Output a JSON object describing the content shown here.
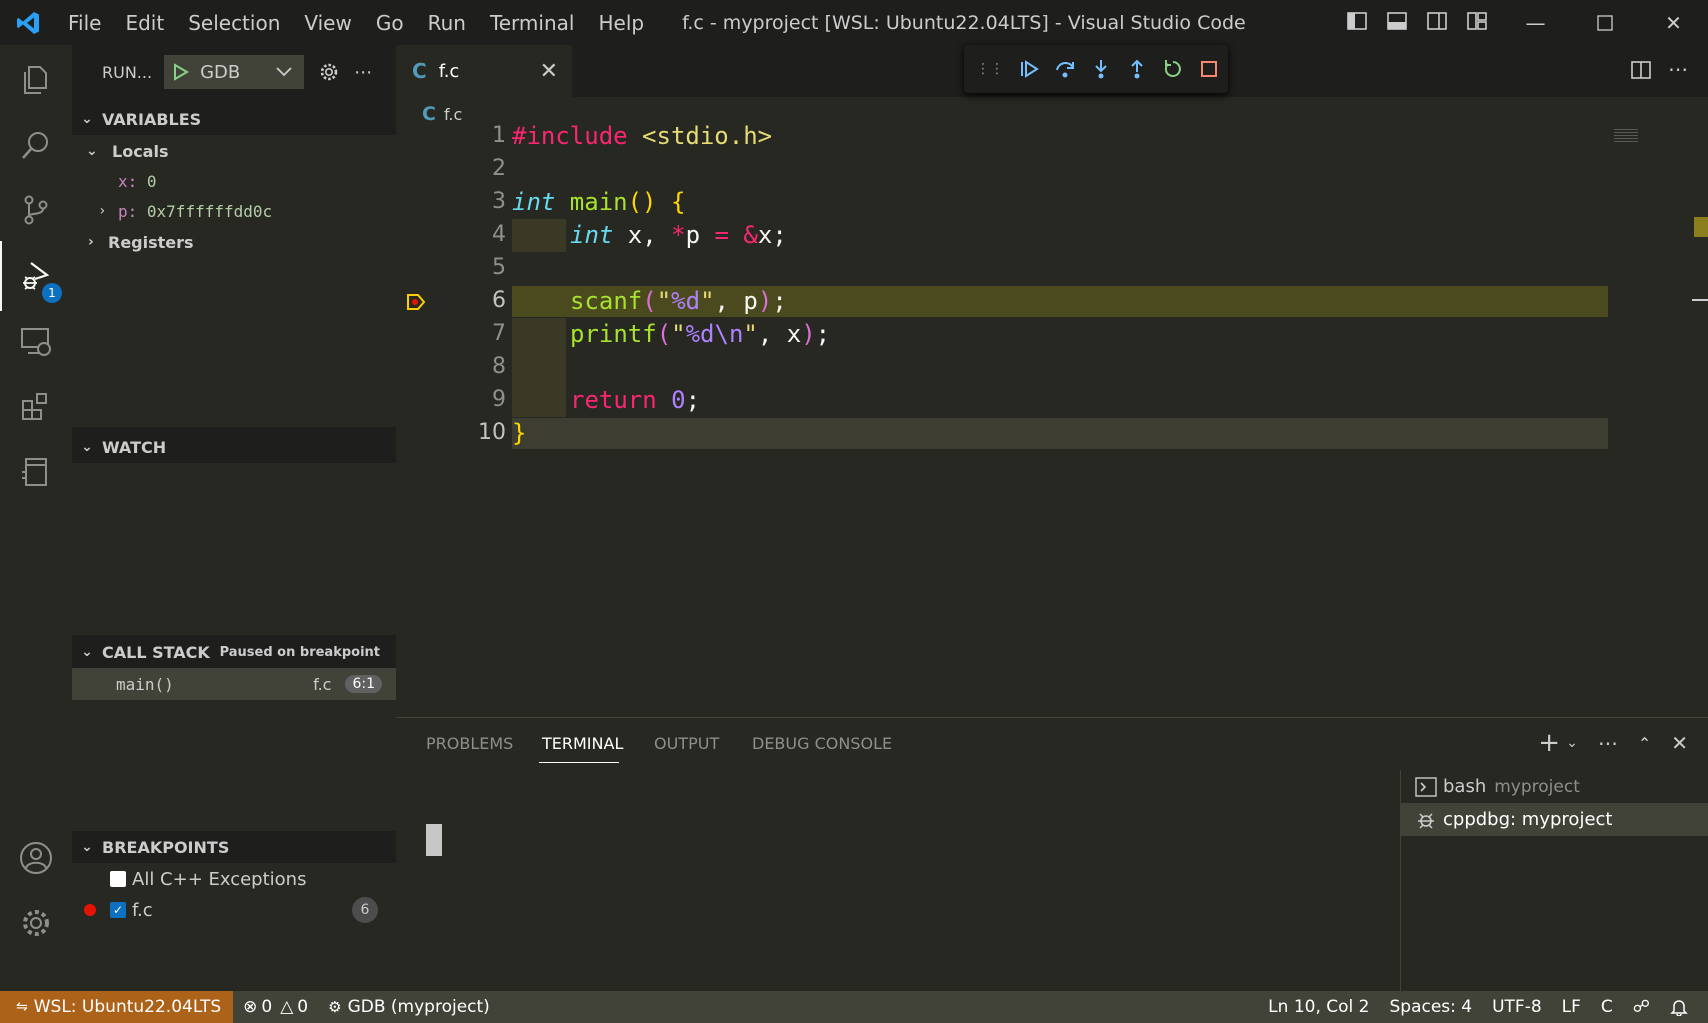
{
  "window": {
    "title": "f.c - myproject [WSL: Ubuntu22.04LTS] - Visual Studio Code",
    "menu": [
      "File",
      "Edit",
      "Selection",
      "View",
      "Go",
      "Run",
      "Terminal",
      "Help"
    ]
  },
  "activity_bar": {
    "debug_badge": "1"
  },
  "sidebar": {
    "run_label": "RUN...",
    "config": "GDB",
    "variables": {
      "header": "VARIABLES",
      "locals_label": "Locals",
      "items": [
        {
          "name": "x:",
          "value": "0"
        },
        {
          "name": "p:",
          "value": "0x7ffffffdd0c"
        }
      ],
      "registers_label": "Registers"
    },
    "watch": {
      "header": "WATCH"
    },
    "call_stack": {
      "header": "CALL STACK",
      "status": "Paused on breakpoint",
      "frames": [
        {
          "name": "main()",
          "file": "f.c",
          "position": "6:1"
        }
      ]
    },
    "breakpoints": {
      "header": "BREAKPOINTS",
      "items": [
        {
          "label": "All C++ Exceptions",
          "checked": false
        },
        {
          "label": "f.c",
          "checked": true,
          "line": "6"
        }
      ]
    }
  },
  "editor": {
    "tab_label": "f.c",
    "breadcrumb_file": "f.c",
    "line_numbers": [
      "1",
      "2",
      "3",
      "4",
      "5",
      "6",
      "7",
      "8",
      "9",
      "10"
    ],
    "lines": {
      "l1": {
        "a": "#include",
        "b": " <stdio.h>"
      },
      "l3": {
        "type": "int",
        "fn": " main",
        "paren": "()",
        "sp": " ",
        "brace": "{"
      },
      "l4": {
        "type": "int",
        "t1": " x, ",
        "star": "*",
        "t2": "p ",
        "eq": "=",
        "sp": " ",
        "amp": "&",
        "t3": "x;"
      },
      "l6": {
        "fn": "scanf",
        "op": "(",
        "str": "\"",
        "fmt": "%d",
        "str2": "\"",
        "t1": ", p",
        "cp": ")",
        "end": ";"
      },
      "l7": {
        "fn": "printf",
        "op": "(",
        "str": "\"",
        "fmt": "%d\\n",
        "str2": "\"",
        "t1": ", x",
        "cp": ")",
        "end": ";"
      },
      "l9": {
        "kw": "return",
        "sp": " ",
        "num": "0",
        "end": ";"
      },
      "l10": {
        "brace": "}"
      }
    }
  },
  "panel": {
    "tabs": [
      "PROBLEMS",
      "TERMINAL",
      "OUTPUT",
      "DEBUG CONSOLE"
    ],
    "active_tab": "TERMINAL",
    "terminals": [
      {
        "name": "bash",
        "desc": "myproject"
      },
      {
        "name": "cppdbg: myproject",
        "desc": ""
      }
    ]
  },
  "status_bar": {
    "remote": "WSL: Ubuntu22.04LTS",
    "errors": "0",
    "warnings": "0",
    "debug": "GDB (myproject)",
    "position": "Ln 10, Col 2",
    "spaces": "Spaces: 4",
    "encoding": "UTF-8",
    "eol": "LF",
    "language": "C"
  },
  "colors": {
    "accent": "#0e70c0",
    "remote_bg": "#ac6218",
    "current_line": "#4b4a1e",
    "breakpoint": "#e51400"
  }
}
